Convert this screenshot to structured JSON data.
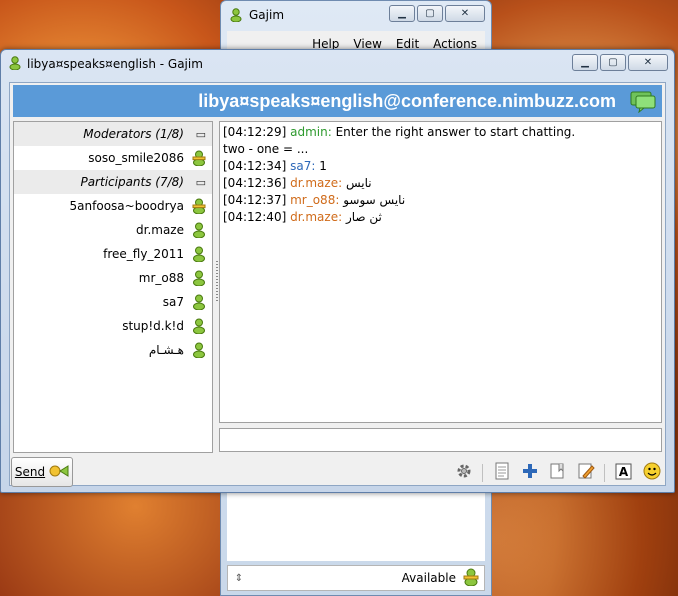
{
  "roster_window": {
    "title": "Gajim",
    "menu": [
      "Help",
      "View",
      "Edit",
      "Actions"
    ],
    "status": "Available"
  },
  "chat_window": {
    "title": "libya¤speaks¤english - Gajim",
    "room_jid": "libya¤speaks¤english@conference.nimbuzz.com",
    "groups": {
      "moderators": "Moderators (1/8)",
      "participants": "Participants (7/8)"
    },
    "moderators": [
      "soso_smile2086"
    ],
    "participants": [
      "5anfoosa~boodrya",
      "dr.maze",
      "free_fly_2011",
      "mr_o88",
      "sa7",
      "stup!d.k!d",
      "هـشـام"
    ],
    "messages": [
      {
        "time": "[04:12:29]",
        "nick": "admin:",
        "text": " Enter the right answer to start chatting.",
        "kind": "admin"
      },
      {
        "time": "",
        "nick": "",
        "text": "two - one = ...",
        "kind": "plain"
      },
      {
        "time": "[04:12:34]",
        "nick": "sa7:",
        "text": " 1",
        "kind": "self"
      },
      {
        "time": "[04:12:36]",
        "nick": "dr.maze:",
        "text": " نايس",
        "kind": "other"
      },
      {
        "time": "[04:12:37]",
        "nick": "mr_o88:",
        "text": " نايس سوسو",
        "kind": "other"
      },
      {
        "time": "[04:12:40]",
        "nick": "dr.maze:",
        "text": " ثن صار",
        "kind": "other"
      }
    ],
    "send_label": "Send"
  },
  "colors": {
    "banner": "#5a9ad8",
    "admin_nick": "#2e9a2e",
    "self_nick": "#2d68b8",
    "other_nick": "#d06b1a"
  },
  "icons": {
    "window_minimize": "minimize-icon",
    "window_maximize": "maximize-icon",
    "window_close": "close-icon",
    "toolbar": [
      "settings-gear-icon",
      "history-icon",
      "add-icon",
      "bookmark-icon",
      "edit-icon",
      "font-icon",
      "emoticon-icon"
    ]
  }
}
